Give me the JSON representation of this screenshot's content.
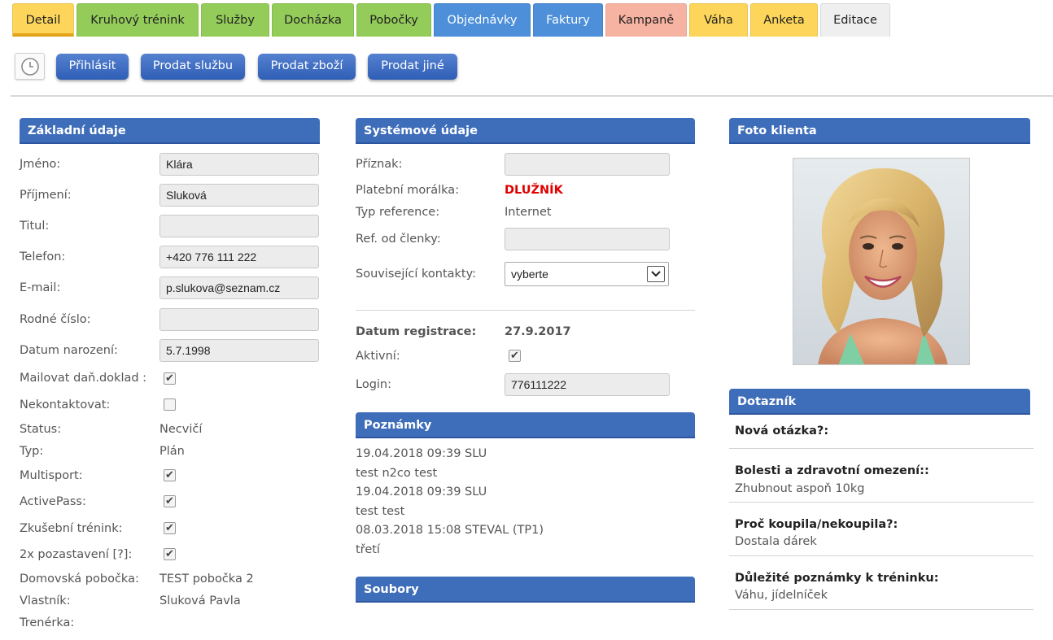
{
  "tabs": [
    {
      "label": "Detail",
      "color": "#fcd55a",
      "selected": true
    },
    {
      "label": "Kruhový trénink",
      "color": "#94cc5a"
    },
    {
      "label": "Služby",
      "color": "#94cc5a"
    },
    {
      "label": "Docházka",
      "color": "#94cc5a"
    },
    {
      "label": "Pobočky",
      "color": "#94cc5a"
    },
    {
      "label": "Objednávky",
      "color": "#4d8fd9"
    },
    {
      "label": "Faktury",
      "color": "#4d8fd9"
    },
    {
      "label": "Kampaně",
      "color": "#f7b3a2"
    },
    {
      "label": "Váha",
      "color": "#fcd55a"
    },
    {
      "label": "Anketa",
      "color": "#fcd55a"
    },
    {
      "label": "Editace",
      "color": "#efefef"
    }
  ],
  "toolbar": {
    "clock_icon": "clock-icon",
    "login": "Přihlásit",
    "sell_service": "Prodat službu",
    "sell_goods": "Prodat zboží",
    "sell_other": "Prodat jiné",
    "button_color": "#3b66bf"
  },
  "basic": {
    "title": "Základní údaje",
    "name_label": "Jméno:",
    "name": "Klára",
    "surname_label": "Příjmení:",
    "surname": "Sluková",
    "title_label": "Titul:",
    "degree": "",
    "phone_label": "Telefon:",
    "phone": "+420 776 111 222",
    "email_label": "E-mail:",
    "email": "p.slukova@seznam.cz",
    "birthnum_label": "Rodné číslo:",
    "birthnum": "",
    "birthdate_label": "Datum narození:",
    "birthdate": "5.7.1998",
    "mail_tax_label": "Mailovat daň.doklad :",
    "mail_tax": true,
    "nocontact_label": "Nekontaktovat:",
    "nocontact": false,
    "status_label": "Status:",
    "status": "Necvičí",
    "type_label": "Typ:",
    "type": "Plán",
    "multisport_label": "Multisport:",
    "multisport": true,
    "activepass_label": "ActivePass:",
    "activepass": true,
    "trial_label": "Zkušební trénink:",
    "trial": true,
    "pause_label": "2x pozastavení [?]:",
    "pause": true,
    "branch_label": "Domovská pobočka:",
    "branch": "TEST pobočka 2",
    "owner_label": "Vlastník:",
    "owner": "Sluková Pavla",
    "trainer_label": "Trenérka:",
    "trainer": ""
  },
  "system": {
    "title": "Systémové údaje",
    "flag_label": "Příznak:",
    "flag": "",
    "morality_label": "Platební morálka:",
    "morality": "DLUŽNÍK",
    "morality_color": "#e00000",
    "reftype_label": "Typ reference:",
    "reftype": "Internet",
    "refmember_label": "Ref. od členky:",
    "refmember": "",
    "related_label": "Související kontakty:",
    "related": "vyberte",
    "regdate_label": "Datum registrace:",
    "regdate": "27.9.2017",
    "active_label": "Aktivní:",
    "active": true,
    "login_label": "Login:",
    "login": "776111222"
  },
  "notes": {
    "title": "Poznámky",
    "items": [
      "19.04.2018 09:39 SLU",
      "test n2co test",
      "19.04.2018 09:39 SLU",
      "test test",
      "08.03.2018 15:08 STEVAL (TP1)",
      "třetí"
    ]
  },
  "files": {
    "title": "Soubory"
  },
  "photo": {
    "title": "Foto klienta"
  },
  "survey": {
    "title": "Dotazník",
    "items": [
      {
        "q": "Nová otázka?:",
        "a": ""
      },
      {
        "q": "Bolesti a zdravotní omezení::",
        "a": "Zhubnout aspoň 10kg"
      },
      {
        "q": "Proč koupila/nekoupila?:",
        "a": "Dostala dárek"
      },
      {
        "q": "Důležité poznámky k tréninku:",
        "a": "Váhu, jídelníček"
      }
    ]
  },
  "colors": {
    "panel_header": "#3e6db9",
    "debtor": "#e00000"
  }
}
